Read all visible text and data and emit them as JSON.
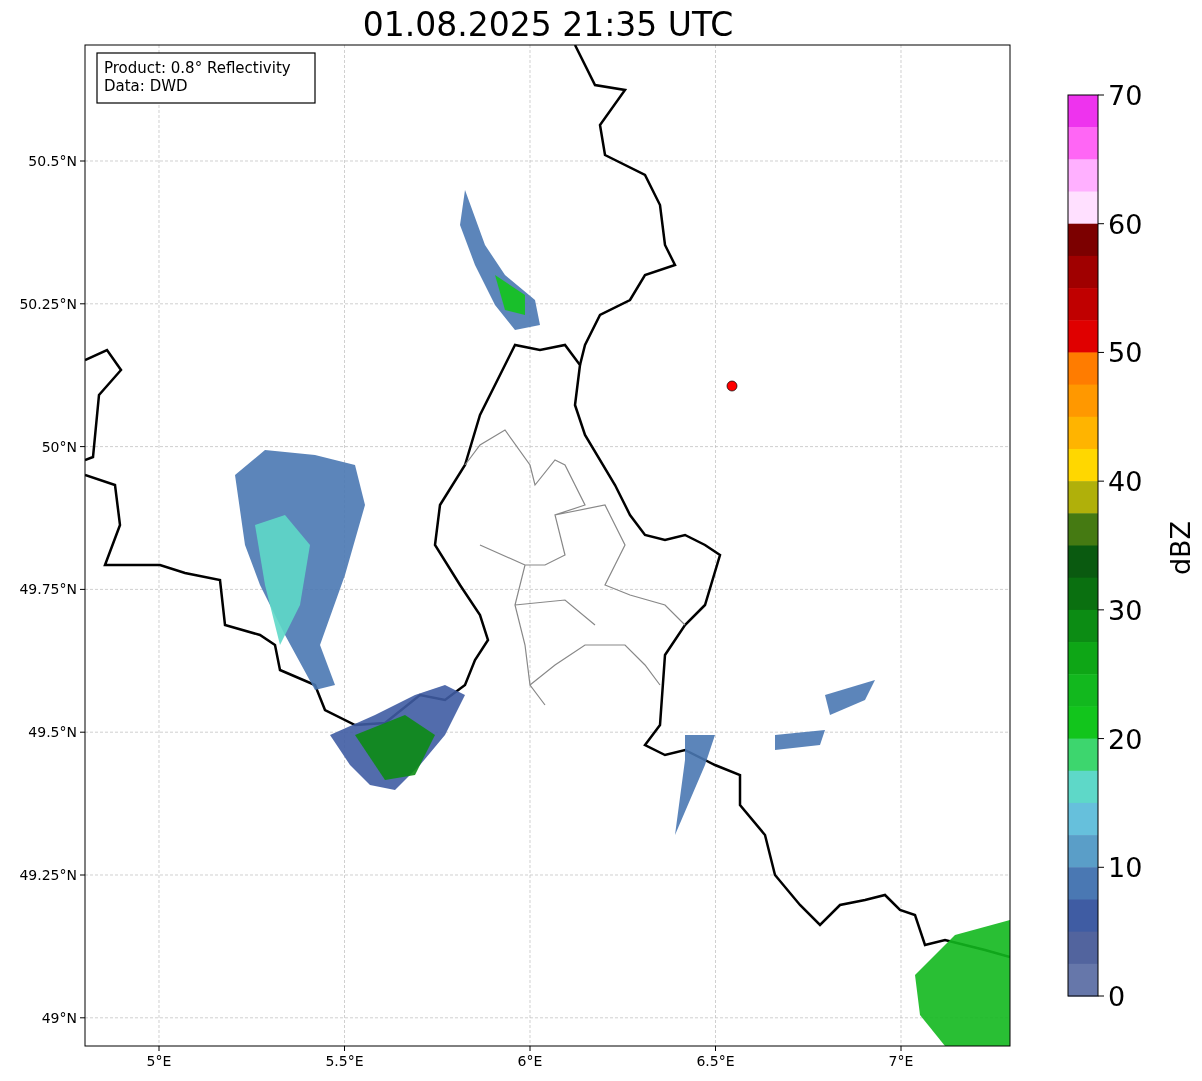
{
  "title": "01.08.2025 21:35 UTC",
  "info_box": {
    "lines": [
      "Product: 0.8° Reflectivity",
      "Data: DWD"
    ]
  },
  "map": {
    "y_ticks": [
      "50.5°N",
      "50.25°N",
      "50°N",
      "49.75°N",
      "49.5°N",
      "49.25°N",
      "49°N"
    ],
    "x_ticks": [
      "5°E",
      "5.5°E",
      "6°E",
      "6.5°E",
      "7°E"
    ]
  },
  "colorbar": {
    "label": "dBZ",
    "ticks": [
      "70",
      "60",
      "50",
      "40",
      "30",
      "20",
      "10",
      "0"
    ],
    "bins": [
      {
        "color": "#ee33ee"
      },
      {
        "color": "#ff66f5"
      },
      {
        "color": "#ffb0ff"
      },
      {
        "color": "#ffe0ff"
      },
      {
        "color": "#7c0000"
      },
      {
        "color": "#a00000"
      },
      {
        "color": "#c00000"
      },
      {
        "color": "#e00000"
      },
      {
        "color": "#ff7c00"
      },
      {
        "color": "#ff9800"
      },
      {
        "color": "#ffb400"
      },
      {
        "color": "#ffd700"
      },
      {
        "color": "#b0b00a"
      },
      {
        "color": "#457a12"
      },
      {
        "color": "#0a5a10"
      },
      {
        "color": "#0a7010"
      },
      {
        "color": "#0c8c14"
      },
      {
        "color": "#0ea616"
      },
      {
        "color": "#12b81e"
      },
      {
        "color": "#12c51c"
      },
      {
        "color": "#3dd66e"
      },
      {
        "color": "#5ed8c8"
      },
      {
        "color": "#66c0dc"
      },
      {
        "color": "#5a9ec8"
      },
      {
        "color": "#4a78b3"
      },
      {
        "color": "#3f5ca3"
      },
      {
        "color": "#52649e"
      },
      {
        "color": "#6677aa"
      }
    ]
  }
}
